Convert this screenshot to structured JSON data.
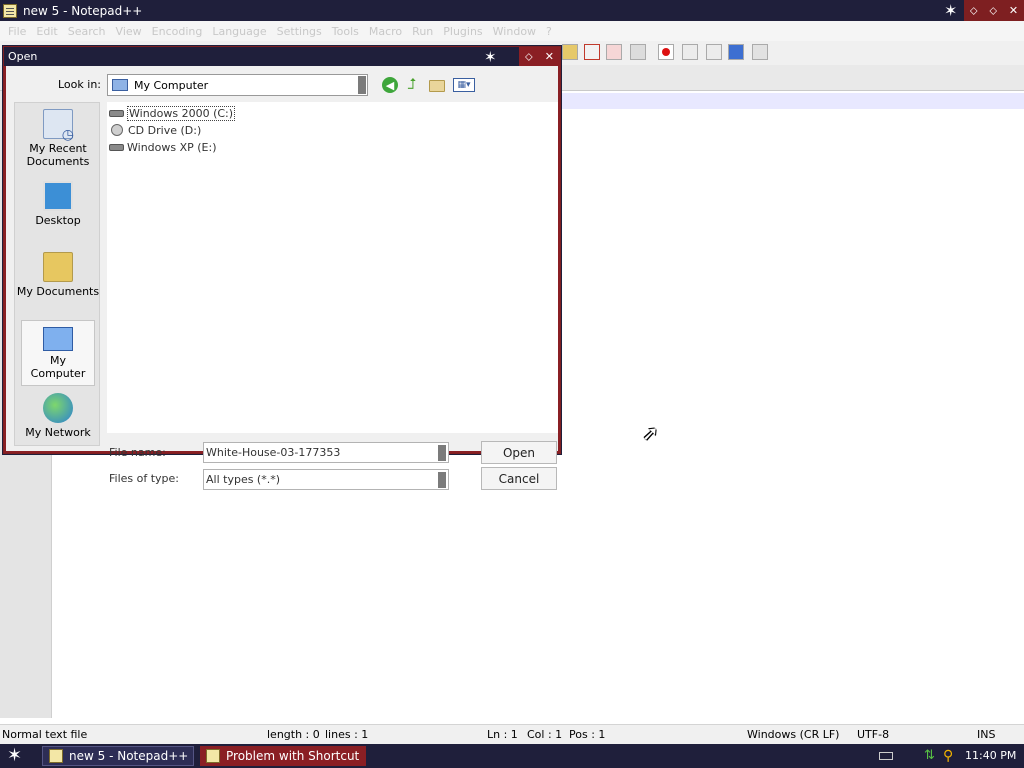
{
  "window": {
    "title": "new 5 - Notepad++",
    "menu": [
      "File",
      "Edit",
      "Search",
      "View",
      "Encoding",
      "Language",
      "Settings",
      "Tools",
      "Macro",
      "Run",
      "Plugins",
      "Window",
      "?"
    ]
  },
  "status_bar": {
    "doc_type": "Normal text file",
    "length": "length : 0",
    "lines": "lines : 1",
    "ln": "Ln : 1",
    "col": "Col : 1",
    "pos": "Pos : 1",
    "eol": "Windows (CR LF)",
    "encoding": "UTF-8",
    "mode": "INS"
  },
  "open_dialog": {
    "title": "Open",
    "look_in_label": "Look in:",
    "look_in_value": "My Computer",
    "places": [
      {
        "label": "My Recent Documents",
        "icon": "recent-documents-icon"
      },
      {
        "label": "Desktop",
        "icon": "desktop-icon"
      },
      {
        "label": "My Documents",
        "icon": "my-documents-icon"
      },
      {
        "label": "My Computer",
        "icon": "my-computer-icon",
        "selected": true
      },
      {
        "label": "My Network",
        "icon": "my-network-icon"
      }
    ],
    "drives": [
      {
        "label": "Windows 2000 (C:)",
        "icon": "hard-drive-icon"
      },
      {
        "label": "CD Drive (D:)",
        "icon": "cd-drive-icon"
      },
      {
        "label": "Windows XP (E:)",
        "icon": "hard-drive-icon"
      }
    ],
    "file_name_label": "File name:",
    "file_name_value": "White-House-03-177353",
    "files_of_type_label": "Files of type:",
    "files_of_type_value": "All types (*.*)",
    "open_button": "Open",
    "cancel_button": "Cancel"
  },
  "taskbar": {
    "tasks": [
      {
        "label": "new 5 - Notepad++"
      },
      {
        "label": "Problem with Shortcut"
      }
    ],
    "clock": "11:40 PM"
  }
}
